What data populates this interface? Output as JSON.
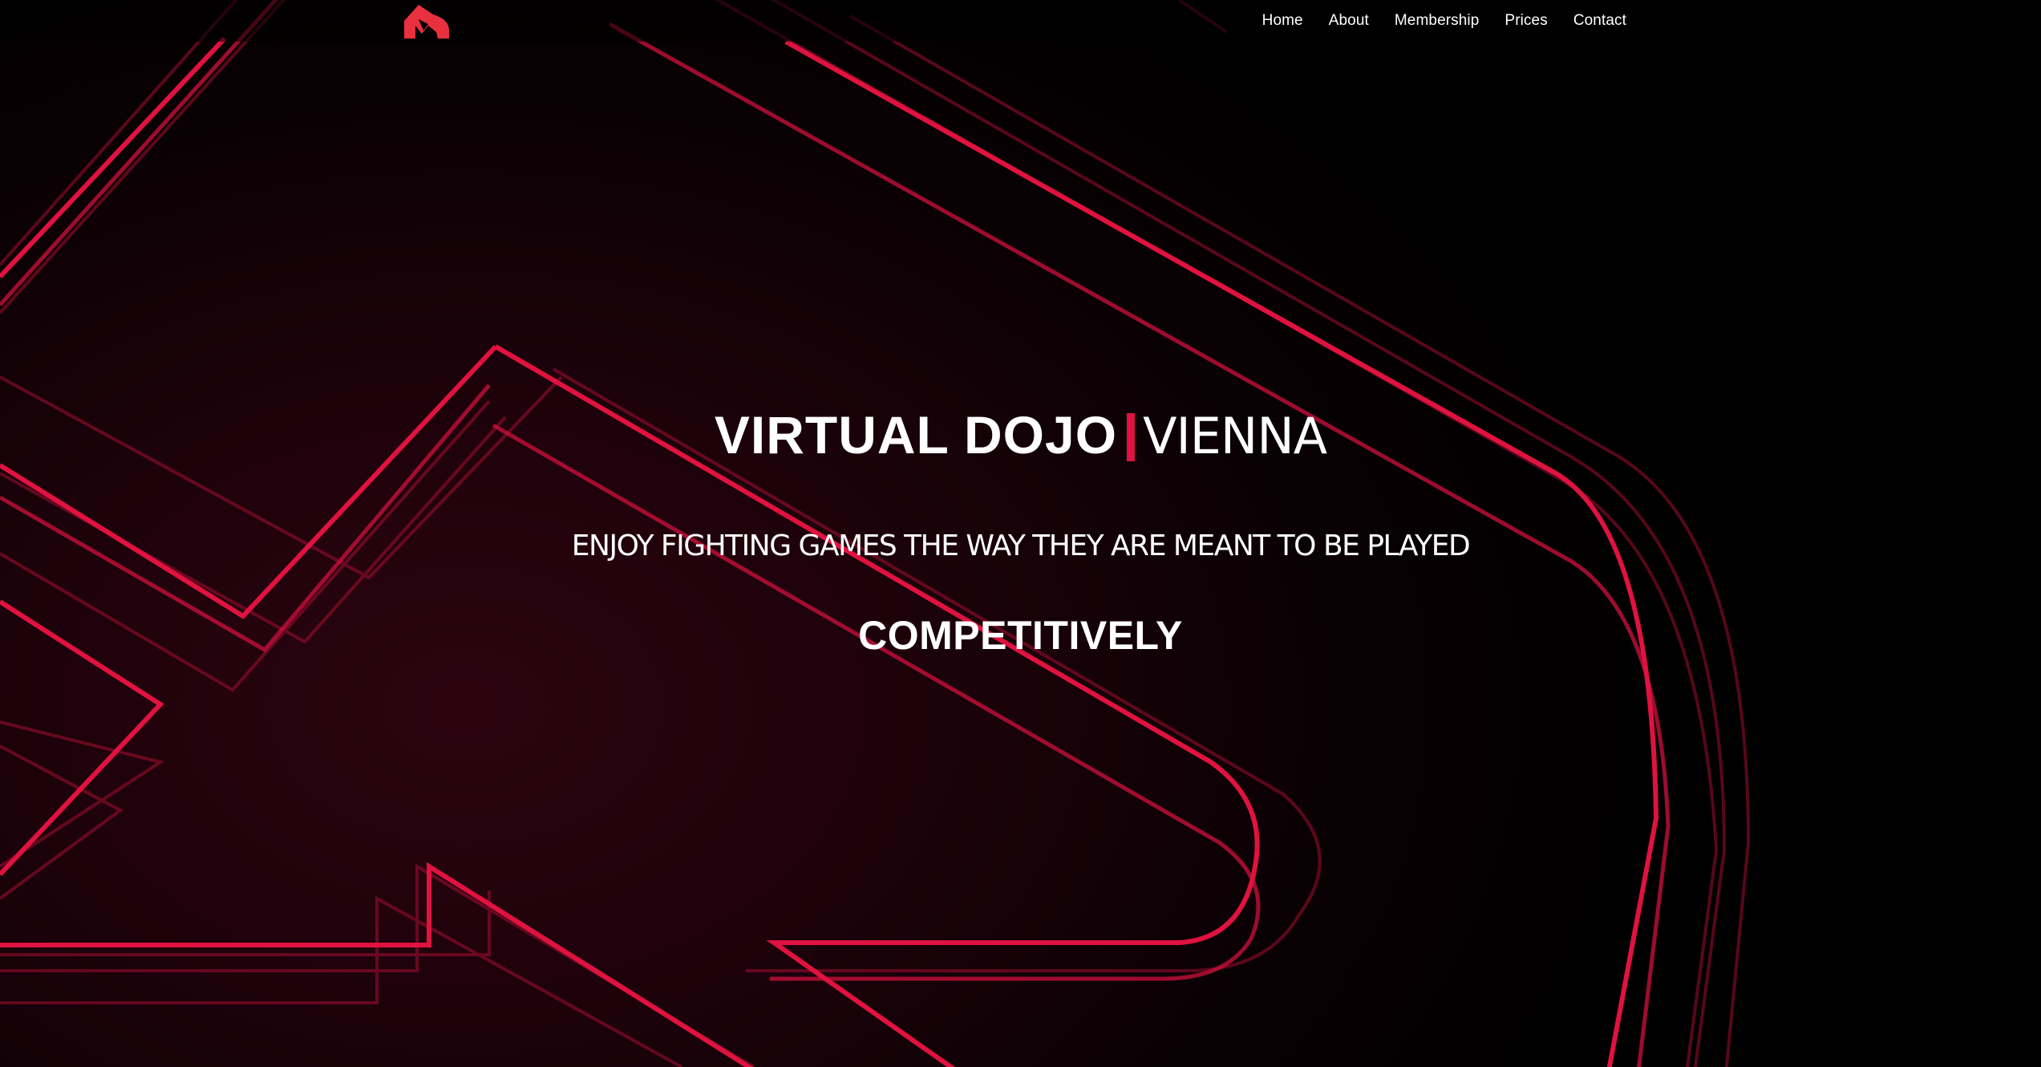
{
  "nav": {
    "logo_icon": "dojo-logo-icon",
    "links": [
      {
        "label": "Home"
      },
      {
        "label": "About"
      },
      {
        "label": "Membership"
      },
      {
        "label": "Prices"
      },
      {
        "label": "Contact"
      }
    ]
  },
  "hero": {
    "title_strong": "VIRTUAL DOJO",
    "title_light": "VIENNA",
    "tagline": "ENJOY FIGHTING GAMES THE WAY THEY ARE MEANT TO BE PLAYED",
    "emphasis": "COMPETITIVELY"
  },
  "theme": {
    "accent": "#e0123f",
    "logo_color": "#e8303f",
    "background": "#000000"
  }
}
